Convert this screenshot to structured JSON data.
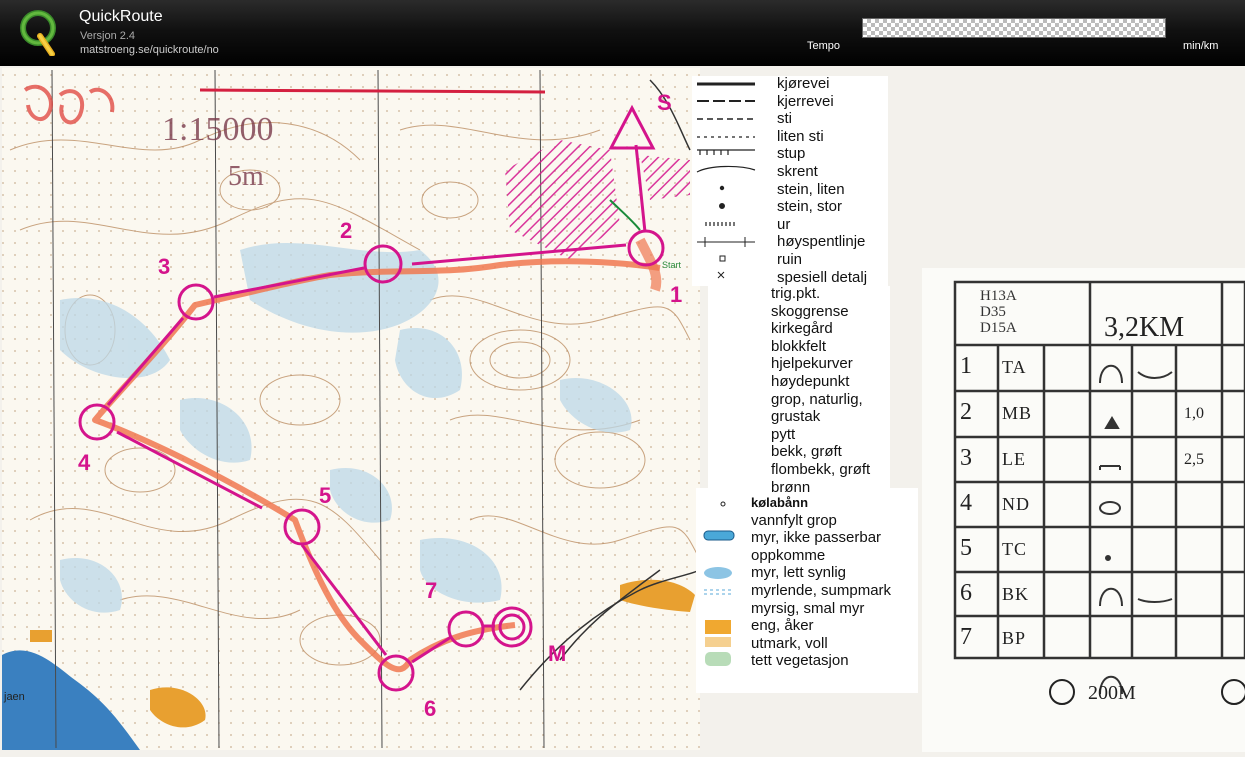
{
  "app": {
    "title": "QuickRoute",
    "version": "Versjon 2.4",
    "url": "matstroeng.se/quickroute/no",
    "tempo_label": "Tempo",
    "unit_label": "min/km"
  },
  "colors": {
    "header_bg": "#000000",
    "course": "#d4148c",
    "route": "#f07850",
    "water": "#bcd8e8"
  },
  "map": {
    "scale_note": "1:15000",
    "equidistance_note": "5m",
    "controls": [
      "S",
      "1",
      "2",
      "3",
      "4",
      "5",
      "6",
      "7",
      "M"
    ],
    "place_name": "jaen",
    "start_note": "Start"
  },
  "legend_1": [
    "kjørevei",
    "kjerrevei",
    "sti",
    "liten sti",
    "stup",
    "skrent",
    "stein, liten",
    "stein, stor",
    "ur",
    "høyspentlinje",
    "ruin",
    "spesiell detalj"
  ],
  "legend_2": [
    "trig.pkt.",
    "skoggrense",
    "kirkegård",
    "blokkfelt",
    "hjelpekurver",
    "høydepunkt",
    "grop, naturlig,",
    "grustak",
    "pytt",
    "bekk, grøft",
    "flombekk, grøft",
    "brønn"
  ],
  "legend_3": [
    "kølabånn",
    "vannfylt grop",
    "myr, ikke passerbar",
    "oppkomme",
    "myr, lett synlig",
    "myrlende, sumpmark",
    "myrsig, smal myr",
    "eng, åker",
    "utmark, voll",
    "tett vegetasjon"
  ],
  "description": {
    "classes": [
      "H13A",
      "D35",
      "D15A"
    ],
    "distance": "3,2KM",
    "rows": [
      {
        "num": "1",
        "code": "TA",
        "value": ""
      },
      {
        "num": "2",
        "code": "MB",
        "value": "1,0"
      },
      {
        "num": "3",
        "code": "LE",
        "value": "2,5"
      },
      {
        "num": "4",
        "code": "ND",
        "value": ""
      },
      {
        "num": "5",
        "code": "TC",
        "value": ""
      },
      {
        "num": "6",
        "code": "BK",
        "value": ""
      },
      {
        "num": "7",
        "code": "BP",
        "value": ""
      }
    ],
    "finish_note": "200M"
  }
}
